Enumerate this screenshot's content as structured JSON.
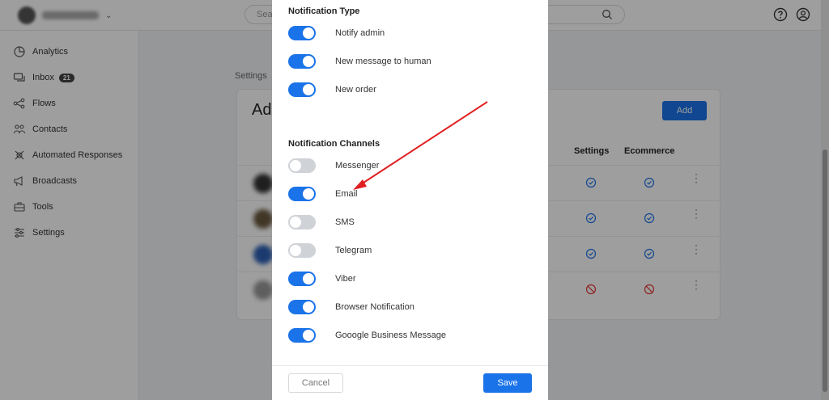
{
  "search": {
    "placeholder": "Sea"
  },
  "sidebar": {
    "items": [
      {
        "label": "Analytics",
        "icon": "analytics-icon"
      },
      {
        "label": "Inbox",
        "icon": "inbox-icon",
        "badge": "21"
      },
      {
        "label": "Flows",
        "icon": "flows-icon"
      },
      {
        "label": "Contacts",
        "icon": "contacts-icon"
      },
      {
        "label": "Automated Responses",
        "icon": "automated-responses-icon"
      },
      {
        "label": "Broadcasts",
        "icon": "broadcasts-icon"
      },
      {
        "label": "Tools",
        "icon": "tools-icon"
      },
      {
        "label": "Settings",
        "icon": "settings-icon"
      }
    ]
  },
  "main": {
    "breadcrumb": "Settings",
    "title": "Ad",
    "add_label": "Add",
    "columns": {
      "settings": "Settings",
      "ecommerce": "Ecommerce"
    },
    "rows": [
      {
        "settings": "ok",
        "ecommerce": "ok"
      },
      {
        "settings": "ok",
        "ecommerce": "ok"
      },
      {
        "settings": "ok",
        "ecommerce": "ok"
      },
      {
        "settings": "blocked",
        "ecommerce": "blocked"
      }
    ]
  },
  "modal": {
    "type_title": "Notification Type",
    "types": [
      {
        "label": "Notify admin",
        "on": true
      },
      {
        "label": "New message to human",
        "on": true
      },
      {
        "label": "New order",
        "on": true
      }
    ],
    "channels_title": "Notification Channels",
    "channels": [
      {
        "label": "Messenger",
        "on": false
      },
      {
        "label": "Email",
        "on": true
      },
      {
        "label": "SMS",
        "on": false
      },
      {
        "label": "Telegram",
        "on": false
      },
      {
        "label": "Viber",
        "on": true
      },
      {
        "label": "Browser Notification",
        "on": true
      },
      {
        "label": "Gooogle Business Message",
        "on": true
      }
    ],
    "cancel_label": "Cancel",
    "save_label": "Save"
  },
  "colors": {
    "accent": "#1a73e8",
    "annotation": "#e02020",
    "toggle_off": "#cfd2d6"
  }
}
